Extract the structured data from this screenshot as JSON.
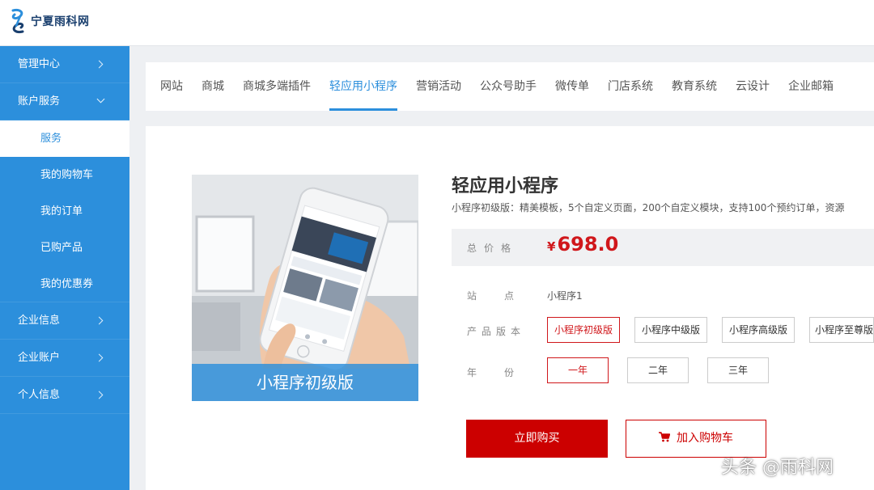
{
  "header": {
    "logo_text": "宁夏雨科网",
    "logo_icon": "swirl-logo-icon"
  },
  "sidebar": {
    "items": [
      {
        "label": "管理中心",
        "icon": "chevron-right-icon"
      },
      {
        "label": "账户服务",
        "icon": "chevron-down-icon"
      }
    ],
    "sub_items": [
      {
        "label": "服务"
      },
      {
        "label": "我的购物车"
      },
      {
        "label": "我的订单"
      },
      {
        "label": "已购产品"
      },
      {
        "label": "我的优惠券"
      }
    ],
    "bottom_items": [
      {
        "label": "企业信息",
        "icon": "chevron-right-icon"
      },
      {
        "label": "企业账户",
        "icon": "chevron-right-icon"
      },
      {
        "label": "个人信息",
        "icon": "chevron-right-icon"
      }
    ],
    "active_sub": "服务"
  },
  "tabs": [
    {
      "label": "网站"
    },
    {
      "label": "商城"
    },
    {
      "label": "商城多端插件"
    },
    {
      "label": "轻应用小程序"
    },
    {
      "label": "营销活动"
    },
    {
      "label": "公众号助手"
    },
    {
      "label": "微传单"
    },
    {
      "label": "门店系统"
    },
    {
      "label": "教育系统"
    },
    {
      "label": "云设计"
    },
    {
      "label": "企业邮箱"
    }
  ],
  "active_tab": "轻应用小程序",
  "product": {
    "image_caption": "小程序初级版",
    "title": "轻应用小程序",
    "description": "小程序初级版：精美模板，5个自定义页面，200个自定义模块，支持100个预约订单，资源",
    "price_label": "总价格",
    "price_currency": "¥",
    "price_value": "698.0",
    "station_label": "站点",
    "station_value": "小程序1",
    "version_label": "产品版本",
    "versions": [
      {
        "label": "小程序初级版",
        "selected": true
      },
      {
        "label": "小程序中级版",
        "selected": false
      },
      {
        "label": "小程序高级版",
        "selected": false
      },
      {
        "label": "小程序至尊版",
        "selected": false
      }
    ],
    "year_label": "年份",
    "years": [
      {
        "label": "一年",
        "selected": true
      },
      {
        "label": "二年",
        "selected": false
      },
      {
        "label": "三年",
        "selected": false
      }
    ]
  },
  "actions": {
    "buy_label": "立即购买",
    "cart_label": "加入购物车",
    "cart_icon": "shopping-cart-icon"
  },
  "watermark": "头条 @雨科网",
  "colors": {
    "sidebar_blue": "#2c8fdc",
    "accent_red": "#cc0000",
    "price_red": "#d0171b"
  }
}
